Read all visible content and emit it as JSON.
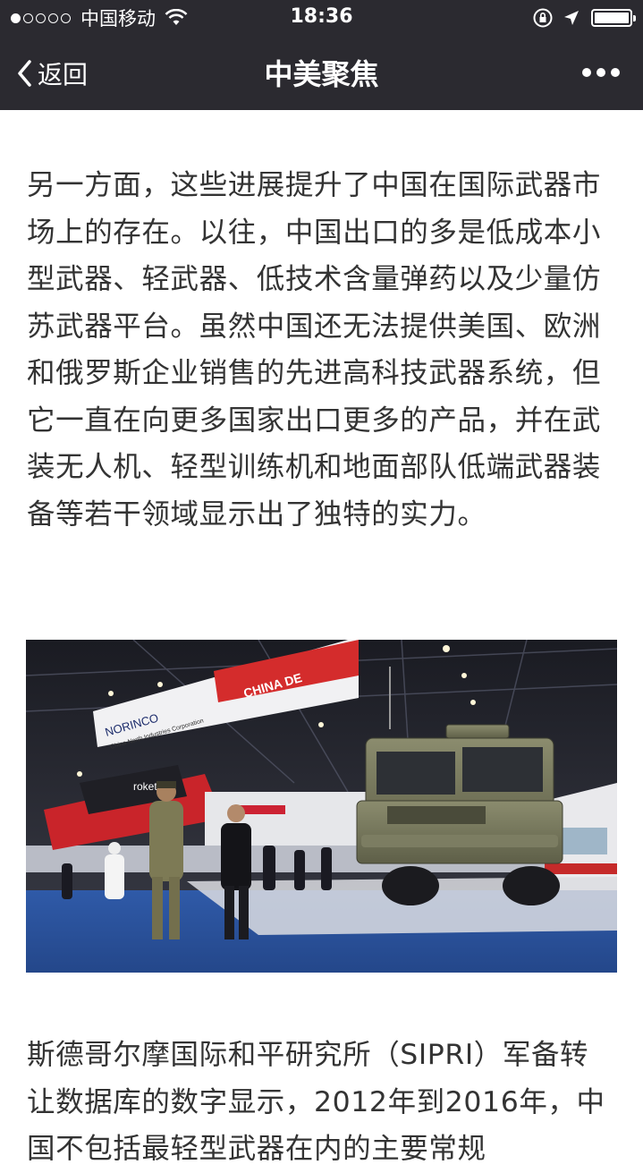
{
  "status_bar": {
    "carrier": "中国移动",
    "time": "18:36",
    "signal_icon": "signal-dots-icon",
    "wifi_icon": "wifi-icon",
    "lock_icon": "orientation-lock-icon",
    "location_icon": "location-arrow-icon",
    "battery_icon": "battery-icon"
  },
  "nav": {
    "back_label": "返回",
    "title": "中美聚焦",
    "more_icon": "more-dots-icon"
  },
  "article": {
    "paragraph_1": "另一方面，这些进展提升了中国在国际武器市场上的存在。以往，中国出口的多是低成本小型武器、轻武器、低技术含量弹药以及少量仿苏武器平台。虽然中国还无法提供美国、欧洲和俄罗斯企业销售的先进高科技武器系统，但它一直在向更多国家出口更多的产品，并在武装无人机、轻型训练机和地面部队低端武器装备等若干领域显示出了独特的实力。",
    "image": {
      "description_icon": "exhibition-photo",
      "sign_norinco": "NORINCO",
      "sign_norinco_sub": "China North Industries Corporation",
      "sign_china_de": "CHINA DE",
      "sign_roketsan": "roketsan"
    },
    "paragraph_2": "斯德哥尔摩国际和平研究所（SIPRI）军备转让数据库的数字显示，2012年到2016年，中国不包括最轻型武器在内的主要常规"
  },
  "colors": {
    "header_bg": "#2b2a30",
    "text": "#333333"
  }
}
